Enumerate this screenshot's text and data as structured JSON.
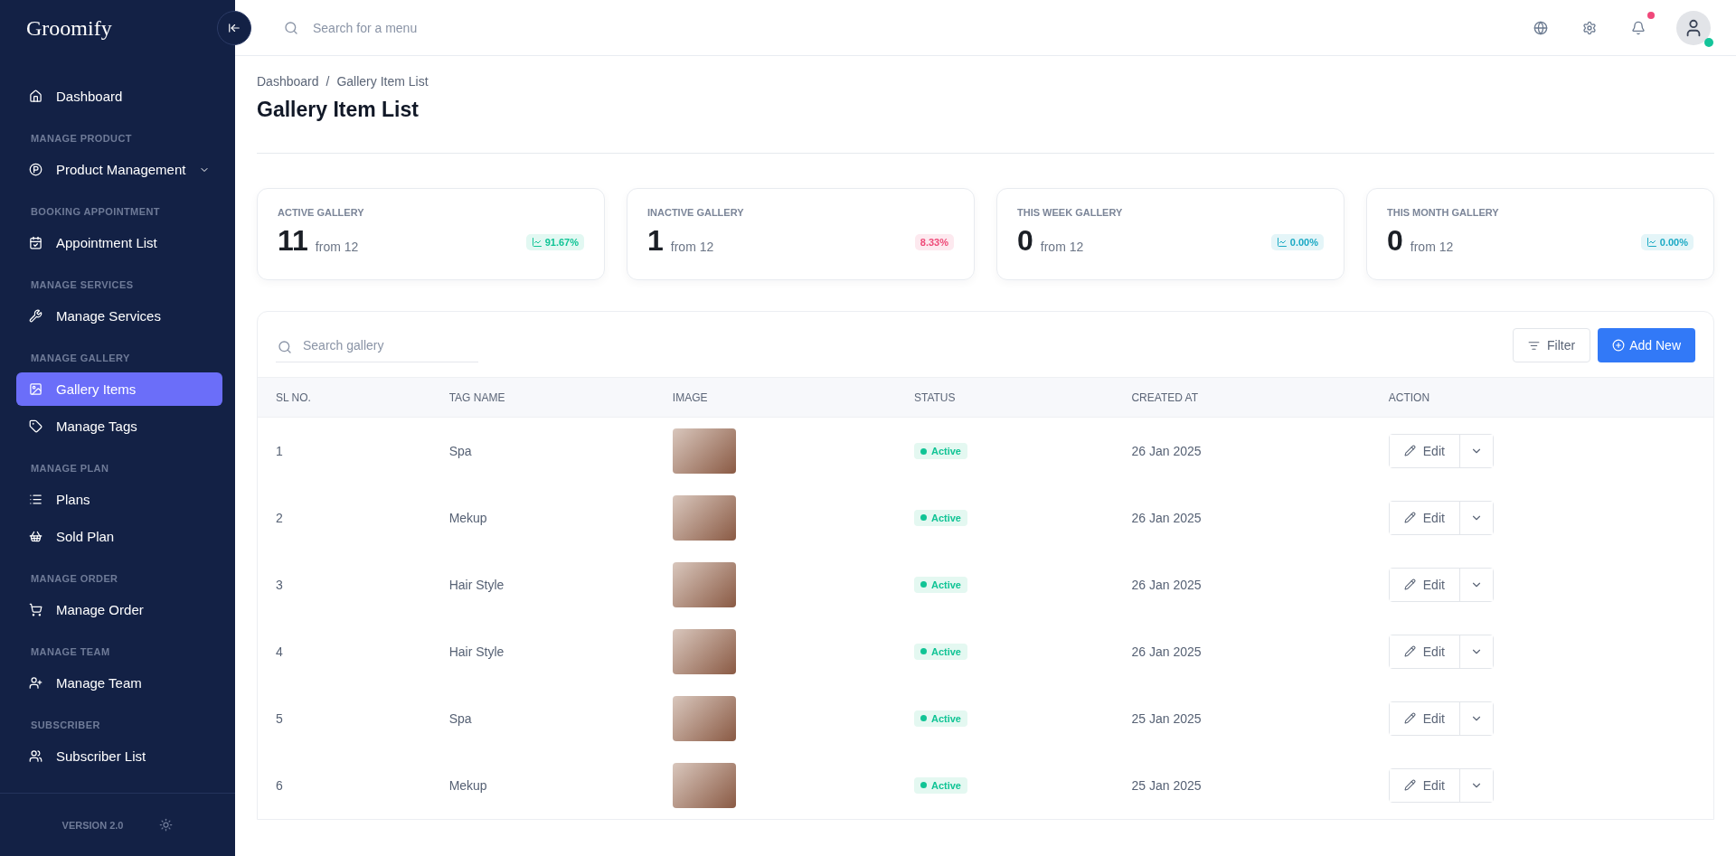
{
  "brand": {
    "name": "Groomify"
  },
  "sidebar": {
    "items": [
      {
        "kind": "item",
        "label": "Dashboard",
        "selected": false
      },
      {
        "kind": "section",
        "label": "MANAGE PRODUCT"
      },
      {
        "kind": "item",
        "label": "Product Management",
        "selected": false,
        "expandable": true
      },
      {
        "kind": "section",
        "label": "BOOKING APPOINTMENT"
      },
      {
        "kind": "item",
        "label": "Appointment List",
        "selected": false
      },
      {
        "kind": "section",
        "label": "MANAGE SERVICES"
      },
      {
        "kind": "item",
        "label": "Manage Services",
        "selected": false
      },
      {
        "kind": "section",
        "label": "MANAGE GALLERY"
      },
      {
        "kind": "item",
        "label": "Gallery Items",
        "selected": true
      },
      {
        "kind": "item",
        "label": "Manage Tags",
        "selected": false
      },
      {
        "kind": "section",
        "label": "MANAGE PLAN"
      },
      {
        "kind": "item",
        "label": "Plans",
        "selected": false
      },
      {
        "kind": "item",
        "label": "Sold Plan",
        "selected": false
      },
      {
        "kind": "section",
        "label": "MANAGE ORDER"
      },
      {
        "kind": "item",
        "label": "Manage Order",
        "selected": false
      },
      {
        "kind": "section",
        "label": "MANAGE TEAM"
      },
      {
        "kind": "item",
        "label": "Manage Team",
        "selected": false
      },
      {
        "kind": "section",
        "label": "SUBSCRIBER"
      },
      {
        "kind": "item",
        "label": "Subscriber List",
        "selected": false
      }
    ],
    "version": "VERSION 2.0"
  },
  "header": {
    "search": {
      "placeholder": "Search for a menu"
    },
    "notification_dot": true,
    "online": true
  },
  "breadcrumb": {
    "items": [
      "Dashboard",
      "Gallery Item List"
    ],
    "separator": "/"
  },
  "page_title": "Gallery Item List",
  "stats": [
    {
      "label": "ACTIVE GALLERY",
      "value": "11",
      "from": "from 12",
      "change": "91.67%",
      "trend_icon": true,
      "color": "#10c495"
    },
    {
      "label": "INACTIVE GALLERY",
      "value": "1",
      "from": "from 12",
      "change": "8.33%",
      "trend_icon": false,
      "color": "#ee4a78"
    },
    {
      "label": "THIS WEEK GALLERY",
      "value": "0",
      "from": "from 12",
      "change": "0.00%",
      "trend_icon": true,
      "color": "#1ba9c4"
    },
    {
      "label": "THIS MONTH GALLERY",
      "value": "0",
      "from": "from 12",
      "change": "0.00%",
      "trend_icon": true,
      "color": "#1ba9c4"
    }
  ],
  "table": {
    "search": {
      "placeholder": "Search gallery"
    },
    "filter": "Filter",
    "add_new": "Add New",
    "columns": [
      "SL NO.",
      "TAG NAME",
      "IMAGE",
      "STATUS",
      "CREATED AT",
      "ACTION"
    ],
    "rows": [
      {
        "sl": "1",
        "tag": "Spa",
        "status": "Active",
        "active": true,
        "created": "26 Jan 2025",
        "edit": "Edit"
      },
      {
        "sl": "2",
        "tag": "Mekup",
        "status": "Active",
        "active": true,
        "created": "26 Jan 2025",
        "edit": "Edit"
      },
      {
        "sl": "3",
        "tag": "Hair Style",
        "status": "Active",
        "active": true,
        "created": "26 Jan 2025",
        "edit": "Edit"
      },
      {
        "sl": "4",
        "tag": "Hair Style",
        "status": "Active",
        "active": true,
        "created": "26 Jan 2025",
        "edit": "Edit"
      },
      {
        "sl": "5",
        "tag": "Spa",
        "status": "Active",
        "active": true,
        "created": "25 Jan 2025",
        "edit": "Edit"
      },
      {
        "sl": "6",
        "tag": "Mekup",
        "status": "Active",
        "active": true,
        "created": "25 Jan 2025",
        "edit": "Edit"
      }
    ]
  }
}
